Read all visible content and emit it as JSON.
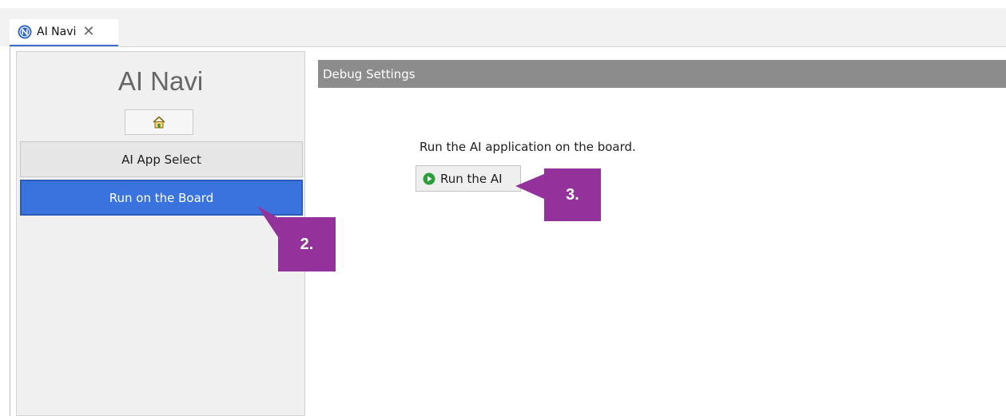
{
  "tab": {
    "title": "AI Navi",
    "close_glyph": "✕",
    "icon": "n-logo-icon"
  },
  "sidebar": {
    "title": "AI Navi",
    "home_icon": "home-icon",
    "items": [
      {
        "label": "AI App Select",
        "selected": false
      },
      {
        "label": "Run on the Board",
        "selected": true
      }
    ]
  },
  "main": {
    "header": "Debug Settings",
    "description": "Run the AI application on the board.",
    "run_button": {
      "label": "Run the AI",
      "icon": "play-icon"
    }
  },
  "callouts": [
    {
      "label": "2.",
      "target": "Run on the Board"
    },
    {
      "label": "3.",
      "target": "Run the AI"
    }
  ],
  "colors": {
    "accent_blue": "#3a73de",
    "callout_purple": "#93329a",
    "header_gray": "#8c8c8c",
    "play_green": "#2e9e3c"
  }
}
